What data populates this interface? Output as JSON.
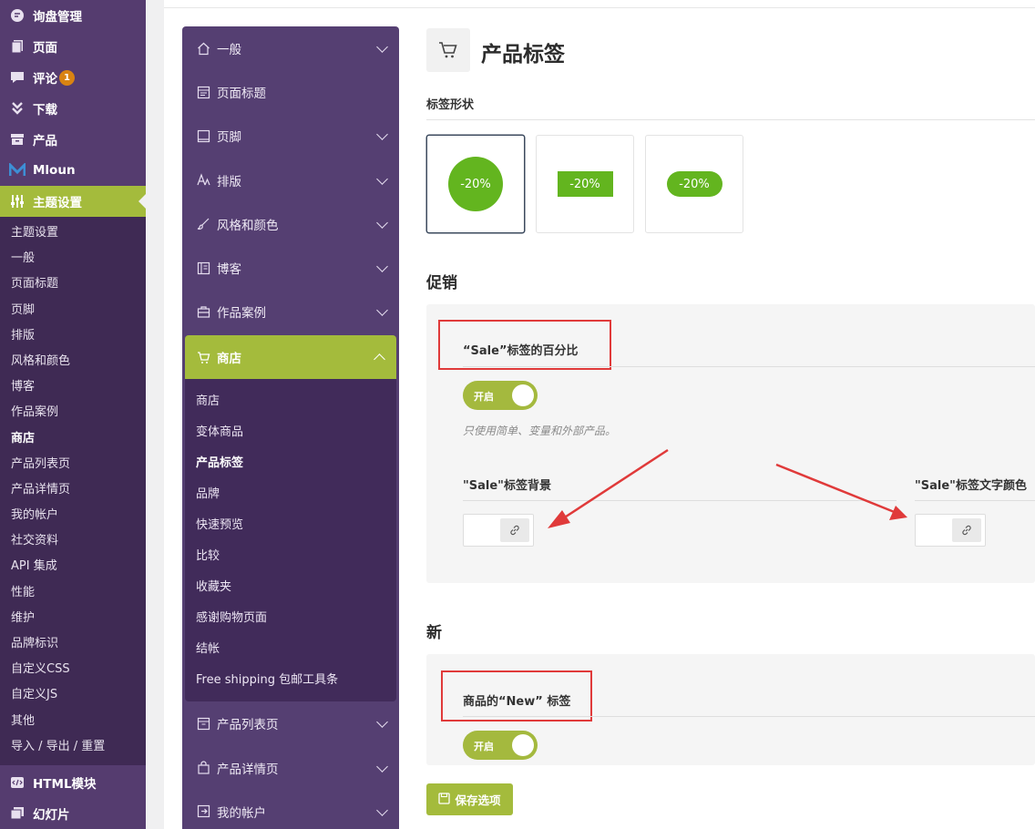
{
  "wp_menu": {
    "top_items": [
      {
        "label": "询盘管理",
        "icon": "inquiry-icon"
      },
      {
        "label": "页面",
        "icon": "pages-icon"
      },
      {
        "label": "评论",
        "icon": "comments-icon",
        "badge": "1"
      },
      {
        "label": "下载",
        "icon": "download-icon"
      },
      {
        "label": "产品",
        "icon": "products-icon"
      },
      {
        "label": "Mloun",
        "icon": "mloun-logo-icon"
      },
      {
        "label": "主题设置",
        "icon": "sliders-icon"
      }
    ],
    "submenu": [
      "主题设置",
      "一般",
      "页面标题",
      "页脚",
      "排版",
      "风格和颜色",
      "博客",
      "作品案例",
      "商店",
      "产品列表页",
      "产品详情页",
      "我的帐户",
      "社交资料",
      "API 集成",
      "性能",
      "维护",
      "品牌标识",
      "自定义CSS",
      "自定义JS",
      "其他",
      "导入 / 导出 / 重置"
    ],
    "current_submenu": "商店",
    "bottom_items": [
      {
        "label": "HTML模块",
        "icon": "html-icon"
      },
      {
        "label": "幻灯片",
        "icon": "slides-icon"
      }
    ]
  },
  "options_nav": {
    "items_before": [
      {
        "label": "一般",
        "icon": "home-icon",
        "chevron": true
      },
      {
        "label": "页面标题",
        "icon": "page-title-icon",
        "chevron": false
      },
      {
        "label": "页脚",
        "icon": "footer-icon",
        "chevron": true
      },
      {
        "label": "排版",
        "icon": "typography-icon",
        "chevron": true
      },
      {
        "label": "风格和颜色",
        "icon": "brush-icon",
        "chevron": true
      },
      {
        "label": "博客",
        "icon": "blog-icon",
        "chevron": true
      },
      {
        "label": "作品案例",
        "icon": "briefcase-icon",
        "chevron": true
      }
    ],
    "active": {
      "label": "商店",
      "icon": "cart-icon"
    },
    "shop_sub": [
      "商店",
      "变体商品",
      "产品标签",
      "品牌",
      "快速预览",
      "比较",
      "收藏夹",
      "感谢购物页面",
      "结帐",
      "Free shipping 包邮工具条"
    ],
    "current_shop_sub": "产品标签",
    "items_after": [
      {
        "label": "产品列表页",
        "icon": "product-list-icon"
      },
      {
        "label": "产品详情页",
        "icon": "product-detail-icon"
      },
      {
        "label": "我的帐户",
        "icon": "account-icon"
      }
    ]
  },
  "main": {
    "title": "产品标签",
    "shape_label": "标签形状",
    "shapes": [
      {
        "text": "-20%",
        "shape": "circle",
        "selected": true
      },
      {
        "text": "-20%",
        "shape": "rectangle",
        "selected": false
      },
      {
        "text": "-20%",
        "shape": "rounded",
        "selected": false
      }
    ],
    "sale_section": {
      "heading": "促销",
      "percent_label": "“Sale”标签的百分比",
      "toggle_label": "开启",
      "toggle_on": true,
      "description": "只使用简单、变量和外部产品。",
      "bg_label": "\"Sale\"标签背景",
      "text_color_label": "\"Sale\"标签文字颜色"
    },
    "new_section": {
      "heading": "新",
      "label": "商品的“New” 标签",
      "toggle_label": "开启",
      "toggle_on": true
    },
    "save_button": "保存选项"
  },
  "colors": {
    "wp_sidebar": "#553c6f",
    "accent": "#a4bb3c",
    "badge_green": "#63b51f",
    "annotation_red": "#e03a3a"
  }
}
